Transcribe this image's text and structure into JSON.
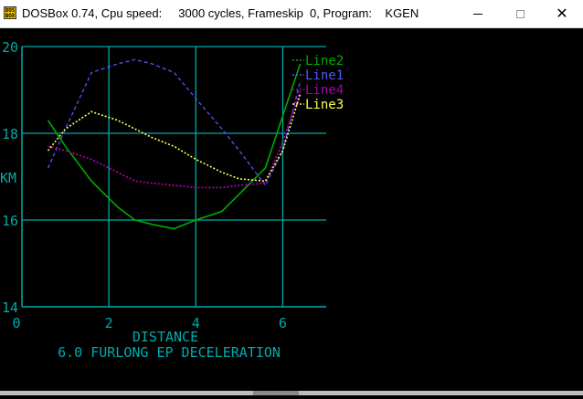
{
  "window": {
    "title": "DOSBox 0.74, Cpu speed:     3000 cycles, Frameskip  0, Program:    KGEN",
    "icon_text": "DOS BOX",
    "minimize_label": "—",
    "close_label": "✕"
  },
  "colors": {
    "axis": "#00aaaa",
    "Line1": "#5555ff",
    "Line2": "#00aa00",
    "Line3": "#ffff55",
    "Line4": "#aa00aa",
    "background": "#000000"
  },
  "chart_data": {
    "type": "line",
    "title": "6.0 FURLONG EP DECELERATION",
    "xlabel": "DISTANCE",
    "ylabel": "KM",
    "xlim": [
      0,
      7
    ],
    "ylim": [
      14,
      20
    ],
    "xticks": [
      "0",
      "2",
      "4",
      "6"
    ],
    "yticks": [
      "14",
      "16",
      "18",
      "20"
    ],
    "grid": true,
    "legend_position": "top-right",
    "series": [
      {
        "name": "Line2",
        "x": [
          0.6,
          1.0,
          1.6,
          2.2,
          2.6,
          3.0,
          3.5,
          4.0,
          4.6,
          5.0,
          5.6,
          6.0,
          6.4
        ],
        "y": [
          18.3,
          17.7,
          16.9,
          16.3,
          16.0,
          15.9,
          15.8,
          16.0,
          16.2,
          16.6,
          17.2,
          18.4,
          19.6
        ]
      },
      {
        "name": "Line1",
        "x": [
          0.6,
          1.0,
          1.6,
          2.2,
          2.6,
          3.0,
          3.5,
          4.0,
          4.6,
          5.0,
          5.6,
          6.0,
          6.4
        ],
        "y": [
          17.2,
          18.1,
          19.4,
          19.6,
          19.7,
          19.6,
          19.4,
          18.8,
          18.1,
          17.6,
          16.8,
          17.6,
          19.2
        ]
      },
      {
        "name": "Line4",
        "x": [
          0.6,
          1.0,
          1.6,
          2.2,
          2.6,
          3.0,
          3.5,
          4.0,
          4.6,
          5.0,
          5.6,
          6.0,
          6.4
        ],
        "y": [
          17.7,
          17.6,
          17.4,
          17.1,
          16.9,
          16.85,
          16.8,
          16.75,
          16.75,
          16.8,
          16.85,
          17.8,
          19.0
        ]
      },
      {
        "name": "Line3",
        "x": [
          0.6,
          1.0,
          1.6,
          2.2,
          2.6,
          3.0,
          3.5,
          4.0,
          4.6,
          5.0,
          5.6,
          6.0,
          6.4
        ],
        "y": [
          17.6,
          18.1,
          18.5,
          18.3,
          18.1,
          17.9,
          17.7,
          17.4,
          17.1,
          16.95,
          16.9,
          17.6,
          18.9
        ]
      }
    ]
  }
}
